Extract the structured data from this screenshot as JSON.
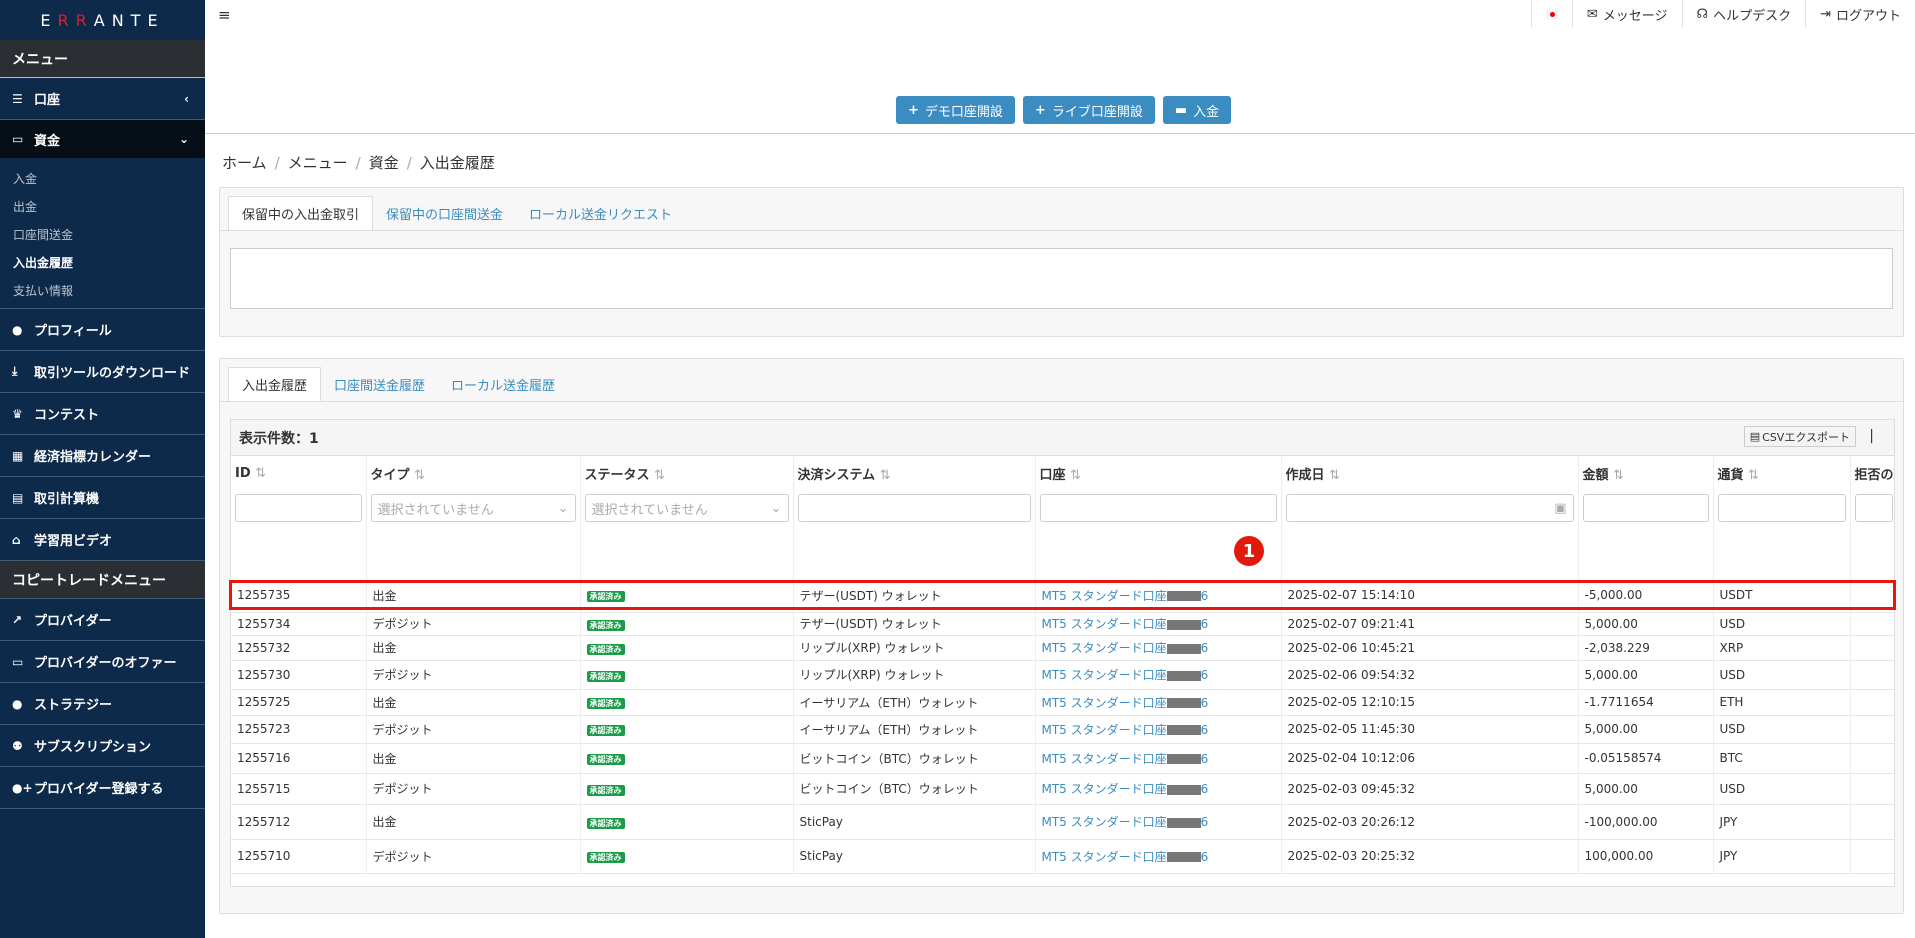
{
  "brand": {
    "logo": "ERRANTE"
  },
  "sidebar": {
    "menu_title": "メニュー",
    "items": [
      {
        "label": "口座"
      },
      {
        "label": "資金"
      }
    ],
    "funds_sub": [
      "入金",
      "出金",
      "口座間送金",
      "入出金履歴",
      "支払い情報"
    ],
    "items2": [
      {
        "label": "プロフィール",
        "icon": "user-icon"
      },
      {
        "label": "取引ツールのダウンロード",
        "icon": "download-icon"
      },
      {
        "label": "コンテスト",
        "icon": "trophy-icon"
      },
      {
        "label": "経済指標カレンダー",
        "icon": "calendar-icon"
      },
      {
        "label": "取引計算機",
        "icon": "calculator-icon"
      },
      {
        "label": "学習用ビデオ",
        "icon": "bank-icon"
      }
    ],
    "copy_title": "コピートレードメニュー",
    "items3": [
      {
        "label": "プロバイダー",
        "icon": "chart-icon"
      },
      {
        "label": "プロバイダーのオファー",
        "icon": "wallet-icon"
      },
      {
        "label": "ストラテジー",
        "icon": "user-icon"
      },
      {
        "label": "サブスクリプション",
        "icon": "users-icon"
      },
      {
        "label": "プロバイダー登録する",
        "icon": "user-plus-icon"
      }
    ]
  },
  "topnav": {
    "messages": "メッセージ",
    "helpdesk": "ヘルプデスク",
    "logout": "ログアウト"
  },
  "actions": {
    "demo": "デモ口座開設",
    "live": "ライブ口座開設",
    "deposit": "入金"
  },
  "breadcrumb": [
    "ホーム",
    "メニュー",
    "資金",
    "入出金履歴"
  ],
  "pending_tabs": [
    "保留中の入出金取引",
    "保留中の口座間送金",
    "ローカル送金リクエスト"
  ],
  "history_tabs": [
    "入出金履歴",
    "口座間送金履歴",
    "ローカル送金履歴"
  ],
  "table": {
    "count_label": "表示件数：1",
    "csv_label": "CSVエクスポート",
    "columns": [
      "ID",
      "タイプ",
      "ステータス",
      "決済システム",
      "口座",
      "作成日",
      "金額",
      "通貨",
      "拒否の理由"
    ],
    "filter_placeholder": "選択されていません",
    "rows": [
      {
        "id": "1255735",
        "type": "出金",
        "status": "承認済み",
        "system": "テザー(USDT) ウォレット",
        "account": "MT5 スタンダード口座",
        "acct_suffix": "6",
        "date": "2025-02-07  15:14:10",
        "amount": "-5,000.00",
        "currency": "USDT"
      },
      {
        "id": "1255734",
        "type": "デポジット",
        "status": "承認済み",
        "system": "テザー(USDT) ウォレット",
        "account": "MT5 スタンダード口座",
        "acct_suffix": "6",
        "date": "2025-02-07  09:21:41",
        "amount": "5,000.00",
        "currency": "USD"
      },
      {
        "id": "1255732",
        "type": "出金",
        "status": "承認済み",
        "system": "リップル(XRP) ウォレット",
        "account": "MT5 スタンダード口座",
        "acct_suffix": "6",
        "date": "2025-02-06  10:45:21",
        "amount": "-2,038.229",
        "currency": "XRP"
      },
      {
        "id": "1255730",
        "type": "デポジット",
        "status": "承認済み",
        "system": "リップル(XRP) ウォレット",
        "account": "MT5 スタンダード口座",
        "acct_suffix": "6",
        "date": "2025-02-06 09:54:32",
        "amount": "5,000.00",
        "currency": "USD"
      },
      {
        "id": "1255725",
        "type": "出金",
        "status": "承認済み",
        "system": "イーサリアム（ETH）ウォレット",
        "account": "MT5 スタンダード口座",
        "acct_suffix": "6",
        "date": "2025-02-05  12:10:15",
        "amount": "-1.7711654",
        "currency": "ETH"
      },
      {
        "id": "1255723",
        "type": "デポジット",
        "status": "承認済み",
        "system": "イーサリアム（ETH）ウォレット",
        "account": "MT5 スタンダード口座",
        "acct_suffix": "6",
        "date": "2025-02-05  11:45:30",
        "amount": "5,000.00",
        "currency": "USD"
      },
      {
        "id": "1255716",
        "type": "出金",
        "status": "承認済み",
        "system": "ビットコイン（BTC）ウォレット",
        "account": "MT5 スタンダード口座",
        "acct_suffix": "6",
        "date": "2025-02-04  10:12:06",
        "amount": "-0.05158574",
        "currency": "BTC"
      },
      {
        "id": "1255715",
        "type": "デポジット",
        "status": "承認済み",
        "system": "ビットコイン（BTC）ウォレット",
        "account": "MT5 スタンダード口座",
        "acct_suffix": "6",
        "date": "2025-02-03  09:45:32",
        "amount": "5,000.00",
        "currency": "USD"
      },
      {
        "id": "1255712",
        "type": "出金",
        "status": "承認済み",
        "system": "SticPay",
        "account": "MT5 スタンダード口座",
        "acct_suffix": "6",
        "date": "2025-02-03  20:26:12",
        "amount": "-100,000.00",
        "currency": "JPY"
      },
      {
        "id": "1255710",
        "type": "デポジット",
        "status": "承認済み",
        "system": "SticPay",
        "account": "MT5 スタンダード口座",
        "acct_suffix": "6",
        "date": "2025-02-03  20:25:32",
        "amount": "100,000.00",
        "currency": "JPY"
      }
    ]
  },
  "annotation": {
    "marker": "1",
    "highlight_color": "#e8160c"
  }
}
